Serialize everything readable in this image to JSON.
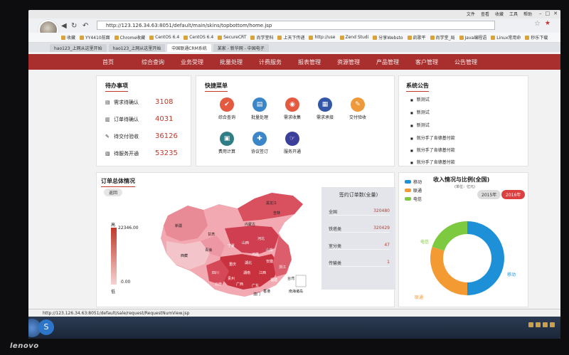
{
  "browser": {
    "top_links": [
      "文件",
      "查看",
      "收藏",
      "工具",
      "帮助"
    ],
    "url": "http://123.126.34.63:8051/default/main/skins/topbottom/home.jsp",
    "favorites": [
      "收藏",
      "YY4410前面",
      "Chrome收藏",
      "CentOS 6.4",
      "CentOS 6.4",
      "SecureCRT",
      "尚学堂科",
      "上天下传递",
      "http://use",
      "Zend Studi",
      "分享Websto",
      "凯歌平",
      "尚学堂_局",
      "Java编程语",
      "Linux常用命",
      "秒乐下载"
    ],
    "tabs": [
      "hao123_上网从这里开始",
      "hao123_上网从这里开始",
      "中国联通CRM系统",
      "某家 - 新华网 - 中国电子"
    ],
    "status_url": "http://123.126.34.63:8051/default/sale/request/RequestNumView.jsp"
  },
  "nav": [
    "首页",
    "综合查询",
    "业务受理",
    "批量处理",
    "计费服务",
    "报表管理",
    "资源管理",
    "产品管理",
    "客户管理",
    "公告管理"
  ],
  "todo": {
    "title": "待办事项",
    "items": [
      {
        "icon": "document-icon",
        "label": "需求待确认",
        "value": "3108"
      },
      {
        "icon": "order-icon",
        "label": "订单待确认",
        "value": "4031"
      },
      {
        "icon": "pen-icon",
        "label": "待交付验收",
        "value": "36126"
      },
      {
        "icon": "service-icon",
        "label": "待服务开通",
        "value": "53235"
      }
    ]
  },
  "quick_menu": {
    "title": "快捷菜单",
    "items": [
      {
        "label": "综合查询",
        "color": "#e35a41",
        "glyph": "✔"
      },
      {
        "label": "批量处理",
        "color": "#3b86c8",
        "glyph": "▤"
      },
      {
        "label": "需求收集",
        "color": "#e35a41",
        "glyph": "◉"
      },
      {
        "label": "需求承接",
        "color": "#3357a8",
        "glyph": "▦"
      },
      {
        "label": "交付验收",
        "color": "#ef9a3a",
        "glyph": "✎"
      },
      {
        "label": "费用计算",
        "color": "#2f7e86",
        "glyph": "▣"
      },
      {
        "label": "协议签订",
        "color": "#3b86c8",
        "glyph": "✚"
      },
      {
        "label": "服务开通",
        "color": "#3a3f9a",
        "glyph": "☞"
      }
    ]
  },
  "notices": {
    "title": "系统公告",
    "items": [
      "新测试",
      "新测试",
      "新测试",
      "就分手了肯德基付款",
      "就分手了肯德基付款",
      "就分手了肯德基付款"
    ]
  },
  "order_overview": {
    "title": "订单总体情况",
    "back": "返回",
    "scale_high": "高",
    "scale_low": "低",
    "scale_max": "22346.00",
    "scale_min": "0.00",
    "map_labels": [
      "黑龙江",
      "吉林",
      "内蒙古",
      "新疆",
      "甘肃",
      "青海",
      "西藏",
      "宁夏",
      "山西",
      "河北",
      "山东",
      "河南",
      "四川",
      "湖北",
      "安徽",
      "江西",
      "湖南",
      "浙江",
      "福建",
      "广东",
      "广西",
      "云南",
      "贵州",
      "重庆",
      "台湾",
      "澳门",
      "香港",
      "南海诸岛"
    ],
    "stats_title": "签约订单数(全量)",
    "stats": [
      {
        "label": "全国",
        "value": "320480"
      },
      {
        "label": "铁塔类",
        "value": "320429"
      },
      {
        "label": "室分类",
        "value": "47"
      },
      {
        "label": "传输类",
        "value": "1"
      }
    ]
  },
  "income": {
    "title": "收入情况与比例(全国)",
    "unit": "(单位：亿元)",
    "years": [
      "2015年",
      "2016年"
    ],
    "active_year": "2016年",
    "legend": [
      {
        "name": "移动",
        "color": "#1e90d8"
      },
      {
        "name": "联通",
        "color": "#f39a33"
      },
      {
        "name": "电信",
        "color": "#7dc93f"
      }
    ],
    "slice_labels": [
      "移动",
      "联通",
      "电信"
    ]
  },
  "chart_data": {
    "type": "pie",
    "title": "收入情况与比例(全国)",
    "categories": [
      "移动",
      "联通",
      "电信"
    ],
    "values": [
      50,
      30,
      20
    ],
    "colors": [
      "#1e90d8",
      "#f39a33",
      "#7dc93f"
    ]
  },
  "taskbar": {
    "brand": "lenovo"
  }
}
